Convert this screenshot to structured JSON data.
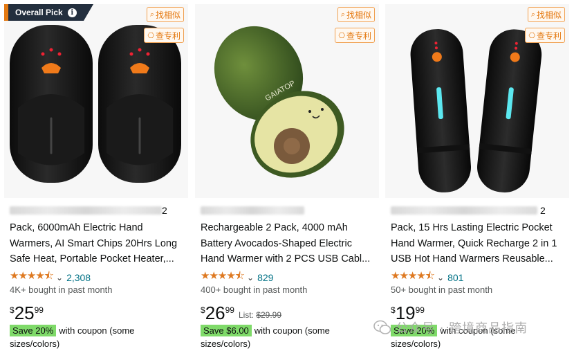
{
  "badge": {
    "label": "Overall Pick",
    "icon": "info-icon"
  },
  "plugin": {
    "find_similar": "找相似",
    "check_patent": "查专利"
  },
  "products": [
    {
      "title_blur_tail": "2",
      "title_lines": [
        "Pack, 6000mAh Electric Hand",
        "Warmers, AI Smart Chips 20Hrs Long",
        "Safe Heat, Portable Pocket Heater,..."
      ],
      "stars": "★★★★⯪",
      "reviews": "2,308",
      "bought": "4K+ bought in past month",
      "price_symbol": "$",
      "price_whole": "25",
      "price_fraction": "99",
      "list_label": "",
      "list_price": "",
      "save": "Save 20%",
      "coupon_text": "with coupon (some sizes/colors)"
    },
    {
      "title_blur_tail": "",
      "title_lines": [
        "Rechargeable 2 Pack, 4000 mAh",
        "Battery Avocados-Shaped Electric",
        "Hand Warmer with 2 PCS USB Cabl..."
      ],
      "stars": "★★★★⯪",
      "reviews": "829",
      "bought": "400+ bought in past month",
      "price_symbol": "$",
      "price_whole": "26",
      "price_fraction": "99",
      "list_label": "List:",
      "list_price": "$29.99",
      "save": "Save $6.00",
      "coupon_text": "with coupon (some sizes/colors)"
    },
    {
      "title_blur_tail": "2",
      "title_lines": [
        "Pack, 15 Hrs Lasting Electric Pocket",
        "Hand Warmer, Quick Recharge 2 in 1",
        "USB Hot Hand Warmers Reusable..."
      ],
      "stars": "★★★★⯪",
      "reviews": "801",
      "bought": "50+ bought in past month",
      "price_symbol": "$",
      "price_whole": "19",
      "price_fraction": "99",
      "list_label": "",
      "list_price": "",
      "save": "Save 20%",
      "coupon_text": "with coupon (some sizes/colors)"
    }
  ],
  "product_images": {
    "avocado_brand": "GAIATOP"
  },
  "watermark": {
    "text": "公众号 · 跨境商品指南"
  },
  "colors": {
    "star": "#de7921",
    "link": "#007185",
    "save_bg": "#7fda69",
    "badge_bg": "#232f3e",
    "plugin_orange": "#e47911"
  }
}
